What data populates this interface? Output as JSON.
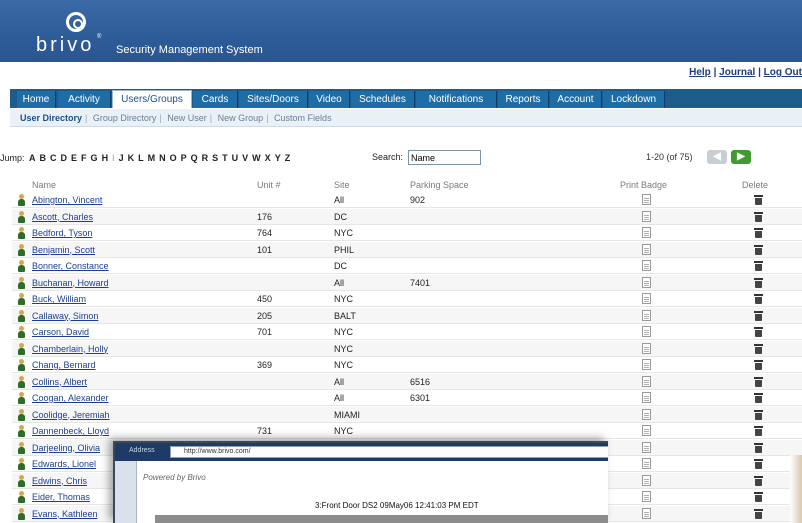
{
  "header": {
    "logo_text": "brivo",
    "logo_mark": "®",
    "app_title": "Security Management System"
  },
  "top_links": {
    "help": "Help",
    "journal": "Journal",
    "logout": "Log Out",
    "separator": "|"
  },
  "tabs": [
    {
      "label": "Home"
    },
    {
      "label": "Activity"
    },
    {
      "label": "Users/Groups",
      "active": true
    },
    {
      "label": "Cards"
    },
    {
      "label": "Sites/Doors"
    },
    {
      "label": "Video"
    },
    {
      "label": "Schedules"
    },
    {
      "label": "Notifications"
    },
    {
      "label": "Reports"
    },
    {
      "label": "Account"
    },
    {
      "label": "Lockdown"
    }
  ],
  "subnav": [
    {
      "label": "User Directory",
      "active": true
    },
    {
      "label": "Group Directory"
    },
    {
      "label": "New User"
    },
    {
      "label": "New Group"
    },
    {
      "label": "Custom Fields"
    }
  ],
  "jump": {
    "label": "Jump:",
    "letters": [
      "A",
      "B",
      "C",
      "D",
      "E",
      "F",
      "G",
      "H",
      "I",
      "J",
      "K",
      "L",
      "M",
      "N",
      "O",
      "P",
      "Q",
      "R",
      "S",
      "T",
      "U",
      "V",
      "W",
      "X",
      "Y",
      "Z"
    ],
    "disabled": [
      "I"
    ]
  },
  "search": {
    "label": "Search:",
    "value": "Name"
  },
  "pager": {
    "range": "1-20 (of 75)",
    "prev_symbol": "◀",
    "next_symbol": "▶"
  },
  "columns": {
    "name": "Name",
    "unit": "Unit #",
    "site": "Site",
    "parking": "Parking Space",
    "print_badge": "Print Badge",
    "delete": "Delete"
  },
  "rows": [
    {
      "name": "Abington, Vincent",
      "unit": "",
      "site": "All",
      "parking": "902"
    },
    {
      "name": "Ascott, Charles",
      "unit": "176",
      "site": "DC",
      "parking": ""
    },
    {
      "name": "Bedford, Tyson",
      "unit": "764",
      "site": "NYC",
      "parking": ""
    },
    {
      "name": "Benjamin, Scott",
      "unit": "101",
      "site": "PHIL",
      "parking": ""
    },
    {
      "name": "Bonner, Constance",
      "unit": "",
      "site": "DC",
      "parking": ""
    },
    {
      "name": "Buchanan, Howard",
      "unit": "",
      "site": "All",
      "parking": "7401"
    },
    {
      "name": "Buck, William",
      "unit": "450",
      "site": "NYC",
      "parking": ""
    },
    {
      "name": "Callaway, Simon",
      "unit": "205",
      "site": "BALT",
      "parking": ""
    },
    {
      "name": "Carson, David",
      "unit": "701",
      "site": "NYC",
      "parking": ""
    },
    {
      "name": "Chamberlain, Holly",
      "unit": "",
      "site": "NYC",
      "parking": ""
    },
    {
      "name": "Chang, Bernard",
      "unit": "369",
      "site": "NYC",
      "parking": ""
    },
    {
      "name": "Collins, Albert",
      "unit": "",
      "site": "All",
      "parking": "6516"
    },
    {
      "name": "Coogan, Alexander",
      "unit": "",
      "site": "All",
      "parking": "6301"
    },
    {
      "name": "Coolidge, Jeremiah",
      "unit": "",
      "site": "MIAMI",
      "parking": ""
    },
    {
      "name": "Dannenbeck, Lloyd",
      "unit": "731",
      "site": "NYC",
      "parking": ""
    },
    {
      "name": "Darjeeling, Olivia",
      "unit": "",
      "site": "",
      "parking": ""
    },
    {
      "name": "Edwards, Lionel",
      "unit": "",
      "site": "",
      "parking": ""
    },
    {
      "name": "Edwins, Chris",
      "unit": "",
      "site": "",
      "parking": ""
    },
    {
      "name": "Eider, Thomas",
      "unit": "",
      "site": "",
      "parking": ""
    },
    {
      "name": "Evans, Kathleen",
      "unit": "",
      "site": "",
      "parking": ""
    }
  ],
  "video_overlay": {
    "address_label": "Address",
    "url": "http://www.brivo.com/",
    "powered_by": "Powered by Brivo",
    "camera_title": "3:Front Door DS2 09May06 12:41:03 PM EDT"
  }
}
